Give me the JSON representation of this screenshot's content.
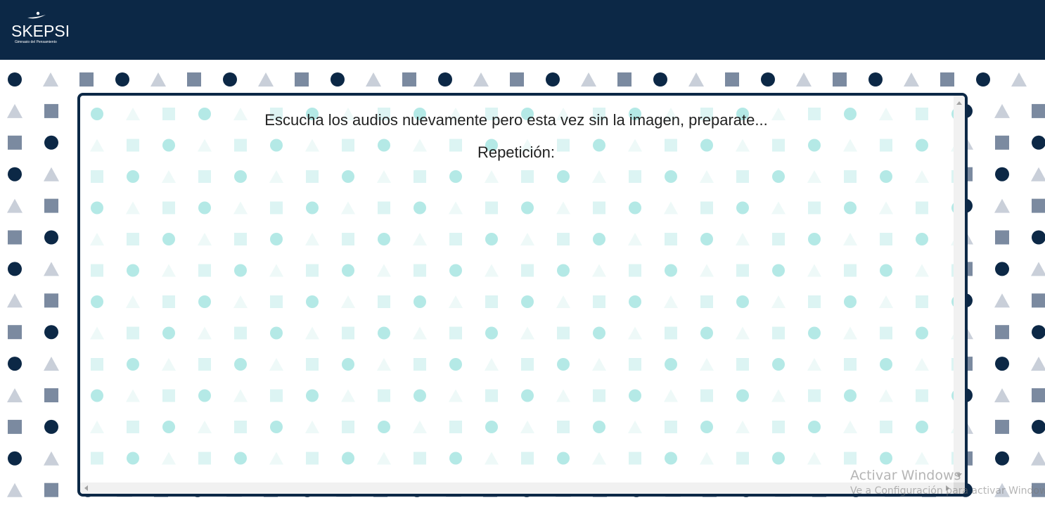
{
  "header": {
    "logo_text": "SKEPSI",
    "logo_tagline": "Gimnasio del Pensamiento"
  },
  "activity": {
    "instruction": "Escucha los audios nuevamente pero esta vez sin la imagen, preparate...",
    "repetition_label": "Repetición:"
  },
  "watermark": {
    "title": "Activar Windows",
    "subtitle": "Ve a Configuración para activar Windows."
  },
  "colors": {
    "header_bg": "#0c2846",
    "circle_dark": "#0c2846",
    "square_gray": "#7b8aa0",
    "triangle_light": "#c9cfd9",
    "inner_circle": "#b4e9e6",
    "inner_square": "#dcf4f3",
    "inner_triangle": "#eef9f8"
  },
  "icons": [
    "logo-swoosh-icon",
    "circle-shape-icon",
    "square-shape-icon",
    "triangle-shape-icon"
  ]
}
